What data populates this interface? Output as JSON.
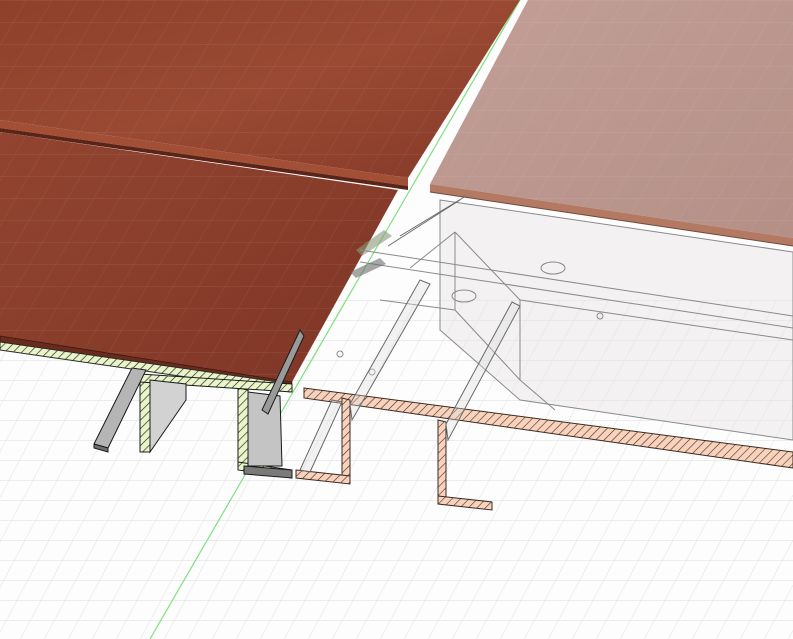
{
  "viewport": {
    "background": "#fdfdfd",
    "grid_color": "#c8c8c8",
    "grid_minor_color": "#e2e2e2",
    "axis_color": "#7fe07f"
  },
  "materials": {
    "tile_top": "#8a3f2a",
    "tile_top_light": "#9c4b33",
    "tile_edge": "#6e2e1e",
    "tile_ghost": "#b58a80",
    "section_green": "#e9f5c8",
    "section_peach": "#f7d2bd",
    "hatch": "#2a2a2a",
    "steel": "#c9c9c9",
    "steel_shadow": "#8c8c8c",
    "ghost_line": "#7a7a7a"
  }
}
